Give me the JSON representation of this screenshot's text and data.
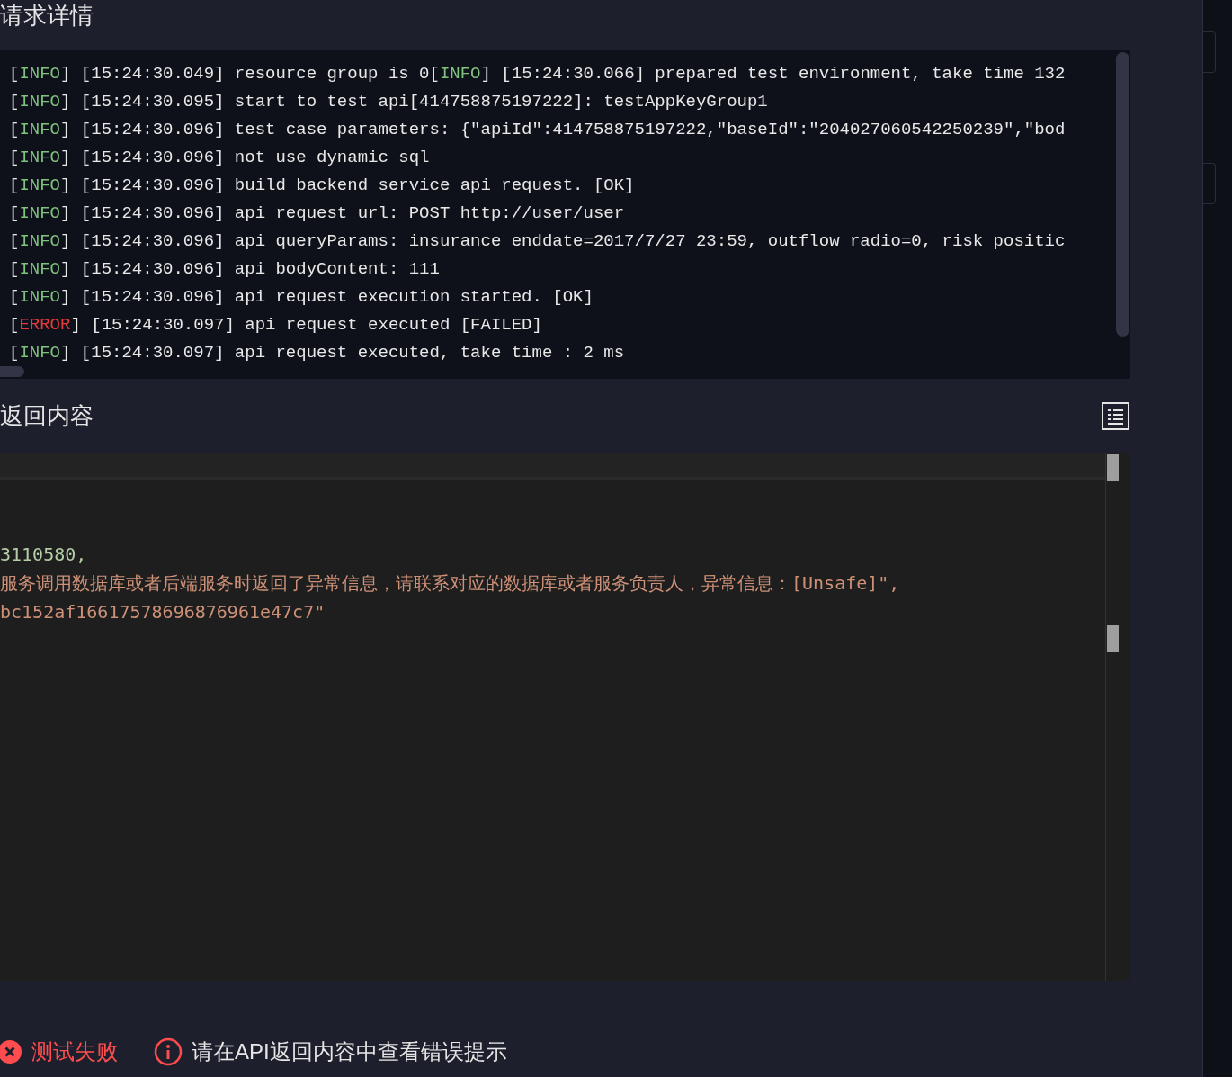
{
  "request_details": {
    "title": "请求详情",
    "log_lines": [
      [
        {
          "kind": "info",
          "open": "[",
          "level": "INFO",
          "close": "]",
          "text": " [15:24:30.049] resource group is 0"
        },
        {
          "kind": "info",
          "open": "[",
          "level": "INFO",
          "close": "]",
          "text": " [15:24:30.066] prepared test environment, take time 132"
        }
      ],
      [
        {
          "kind": "info",
          "open": "[",
          "level": "INFO",
          "close": "]",
          "text": " [15:24:30.095] start to test api[414758875197222]: testAppKeyGroup1"
        }
      ],
      [
        {
          "kind": "info",
          "open": "[",
          "level": "INFO",
          "close": "]",
          "text": " [15:24:30.096] test case parameters: {\"apiId\":414758875197222,\"baseId\":\"204027060542250239\",\"bod"
        }
      ],
      [
        {
          "kind": "info",
          "open": "[",
          "level": "INFO",
          "close": "]",
          "text": " [15:24:30.096] not use dynamic sql"
        }
      ],
      [
        {
          "kind": "info",
          "open": "[",
          "level": "INFO",
          "close": "]",
          "text": " [15:24:30.096] build backend service api request. [OK]"
        }
      ],
      [
        {
          "kind": "info",
          "open": "[",
          "level": "INFO",
          "close": "]",
          "text": " [15:24:30.096] api request url: POST http://user/user"
        }
      ],
      [
        {
          "kind": "info",
          "open": "[",
          "level": "INFO",
          "close": "]",
          "text": " [15:24:30.096] api queryParams: insurance_enddate=2017/7/27 23:59, outflow_radio=0, risk_positic"
        }
      ],
      [
        {
          "kind": "info",
          "open": "[",
          "level": "INFO",
          "close": "]",
          "text": " [15:24:30.096] api bodyContent: 111"
        }
      ],
      [
        {
          "kind": "info",
          "open": "[",
          "level": "INFO",
          "close": "]",
          "text": " [15:24:30.096] api request execution started. [OK]"
        }
      ],
      [
        {
          "kind": "error",
          "open": "[",
          "level": "ERROR",
          "close": "]",
          "text": " [15:24:30.097] api request executed [FAILED]"
        }
      ],
      [
        {
          "kind": "info",
          "open": "[",
          "level": "INFO",
          "close": "]",
          "text": " [15:24:30.097] api request executed, take time : 2 ms"
        }
      ]
    ]
  },
  "response": {
    "title": "返回内容",
    "lines": [
      {
        "kind": "number",
        "text": "3110580,"
      },
      {
        "kind": "string",
        "text": "服务调用数据库或者后端服务时返回了异常信息，请联系对应的数据库或者服务负责人，异常信息：[Unsafe]\","
      },
      {
        "kind": "string",
        "text": "bc152af16617578696876961e47c7\""
      }
    ]
  },
  "status": {
    "result": "测试失败",
    "hint": "请在API返回内容中查看错误提示"
  }
}
